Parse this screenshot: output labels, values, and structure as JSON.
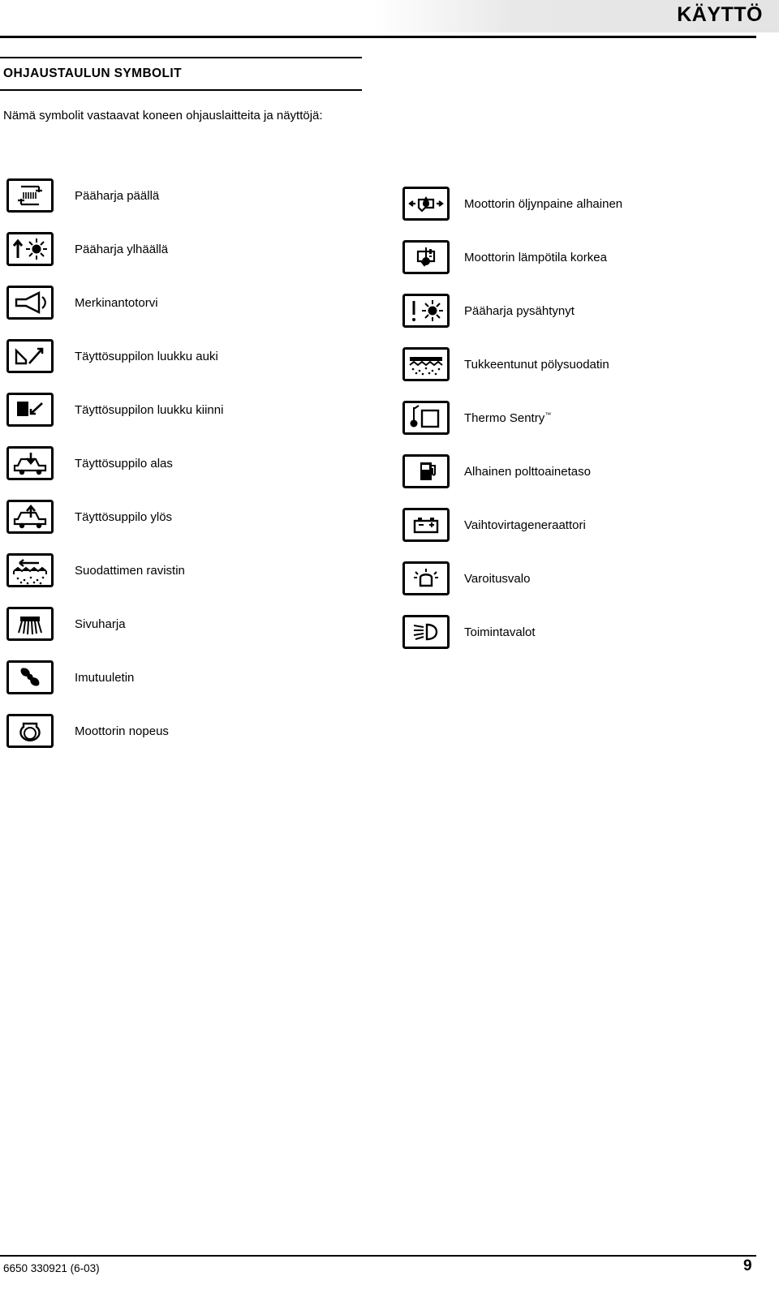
{
  "header": {
    "title": "KÄYTTÖ"
  },
  "section": {
    "title": "OHJAUSTAULUN SYMBOLIT",
    "intro": "Nämä symbolit vastaavat koneen ohjauslaitteita ja näyttöjä:"
  },
  "left_column": [
    {
      "icon": "main-broom-on-icon",
      "label": "Pääharja päällä"
    },
    {
      "icon": "main-broom-up-icon",
      "label": "Pääharja ylhäällä"
    },
    {
      "icon": "horn-icon",
      "label": "Merkinantotorvi"
    },
    {
      "icon": "hopper-door-open-icon",
      "label": "Täyttösuppilon luukku auki"
    },
    {
      "icon": "hopper-door-closed-icon",
      "label": "Täyttösuppilon luukku kiinni"
    },
    {
      "icon": "hopper-down-icon",
      "label": "Täyttösuppilo alas"
    },
    {
      "icon": "hopper-up-icon",
      "label": "Täyttösuppilo ylös"
    },
    {
      "icon": "filter-shaker-icon",
      "label": "Suodattimen ravistin"
    },
    {
      "icon": "side-brush-icon",
      "label": "Sivuharja"
    },
    {
      "icon": "vacuum-fan-icon",
      "label": "Imutuuletin"
    },
    {
      "icon": "engine-speed-icon",
      "label": "Moottorin nopeus"
    }
  ],
  "right_column": [
    {
      "icon": "engine-oil-pressure-low-icon",
      "label": "Moottorin öljynpaine alhainen"
    },
    {
      "icon": "engine-temperature-high-icon",
      "label": "Moottorin lämpötila korkea"
    },
    {
      "icon": "main-broom-stopped-icon",
      "label": "Pääharja pysähtynyt"
    },
    {
      "icon": "clogged-dust-filter-icon",
      "label": "Tukkeentunut pölysuodatin"
    },
    {
      "icon": "thermo-sentry-icon",
      "label": "Thermo Sentry",
      "suffix": "™"
    },
    {
      "icon": "low-fuel-level-icon",
      "label": "Alhainen polttoainetaso"
    },
    {
      "icon": "alternator-icon",
      "label": "Vaihtovirtageneraattori"
    },
    {
      "icon": "warning-light-icon",
      "label": "Varoitusvalo"
    },
    {
      "icon": "work-lights-icon",
      "label": "Toimintavalot"
    }
  ],
  "footer": {
    "document_code": "6650 330921 (6-03)",
    "page_number": "9"
  }
}
